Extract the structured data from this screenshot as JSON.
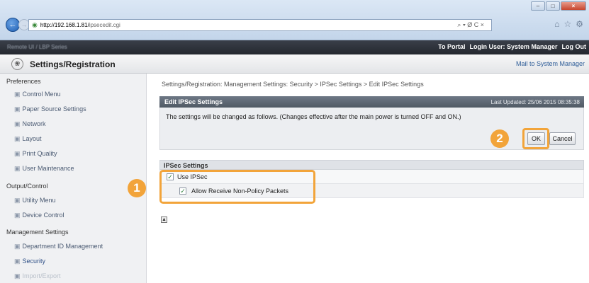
{
  "browser": {
    "address_host": "http://192.168.1.81/",
    "address_path": "ipsecedit.cgi",
    "address_tools": "⌕ ▾ Ø C ×",
    "window_min": "–",
    "window_max": "□",
    "window_close": "×"
  },
  "topbar": {
    "device_name": "Remote UI / LBP Series",
    "portal_link": "To Portal",
    "login_user": "Login User: System Manager",
    "logout_link": "Log Out"
  },
  "header": {
    "title": "Settings/Registration",
    "mail_link": "Mail to System Manager"
  },
  "sidebar": {
    "sections": [
      {
        "label": "Preferences",
        "items": [
          "Control Menu",
          "Paper Source Settings",
          "Network",
          "Layout",
          "Print Quality",
          "User Maintenance"
        ]
      },
      {
        "label": "Output/Control",
        "items": [
          "Utility Menu",
          "Device Control"
        ]
      },
      {
        "label": "Management Settings",
        "items": [
          "Department ID Management",
          "Security",
          "Import/Export"
        ]
      }
    ]
  },
  "breadcrumb": "Settings/Registration: Management Settings: Security > IPSec Settings > Edit IPSec Settings",
  "panel": {
    "title": "Edit IPSec Settings",
    "last_updated": "Last Updated: 25/06 2015 08:35:38",
    "message": "The settings will be changed as follows. (Changes effective after the main power is turned OFF and ON.)",
    "ok_label": "OK",
    "cancel_label": "Cancel"
  },
  "ipsec_settings": {
    "header": "IPSec Settings",
    "use_ipsec_label": "Use IPSec",
    "use_ipsec_checked": true,
    "allow_label": "Allow Receive Non-Policy Packets",
    "allow_checked": true
  },
  "callouts": [
    "1",
    "2"
  ],
  "accent_color": "#f2a43a",
  "top_icon": "▲"
}
